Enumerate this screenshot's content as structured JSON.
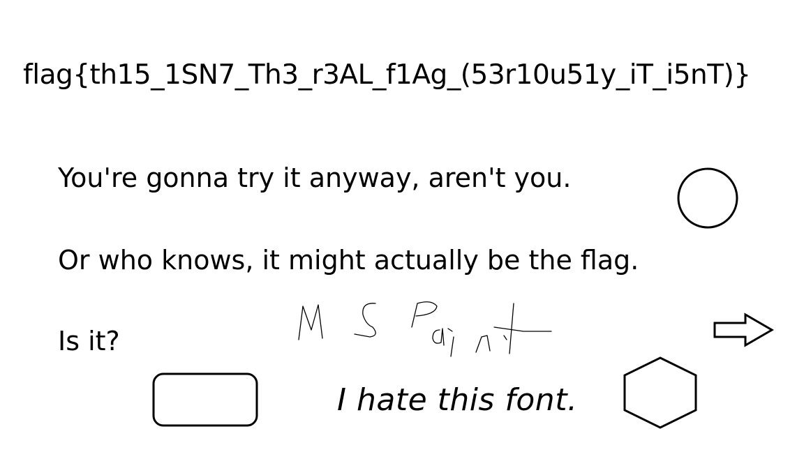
{
  "image": {
    "background": "#ffffff",
    "ink_color": "#000000",
    "flag_text": "flag{th15_1SN7_Th3_r3AL_f1Ag_(53r10u51y_iT_i5nT)}",
    "lines": [
      "You're gonna try it anyway, aren't you.",
      "Or who knows, it might actually be the flag.",
      "Is it?"
    ],
    "comic_text": "I hate this font.",
    "handwritten_scrawl": "MS Paint",
    "shapes": [
      "circle",
      "arrow-right",
      "rounded-rectangle",
      "hexagon"
    ]
  }
}
